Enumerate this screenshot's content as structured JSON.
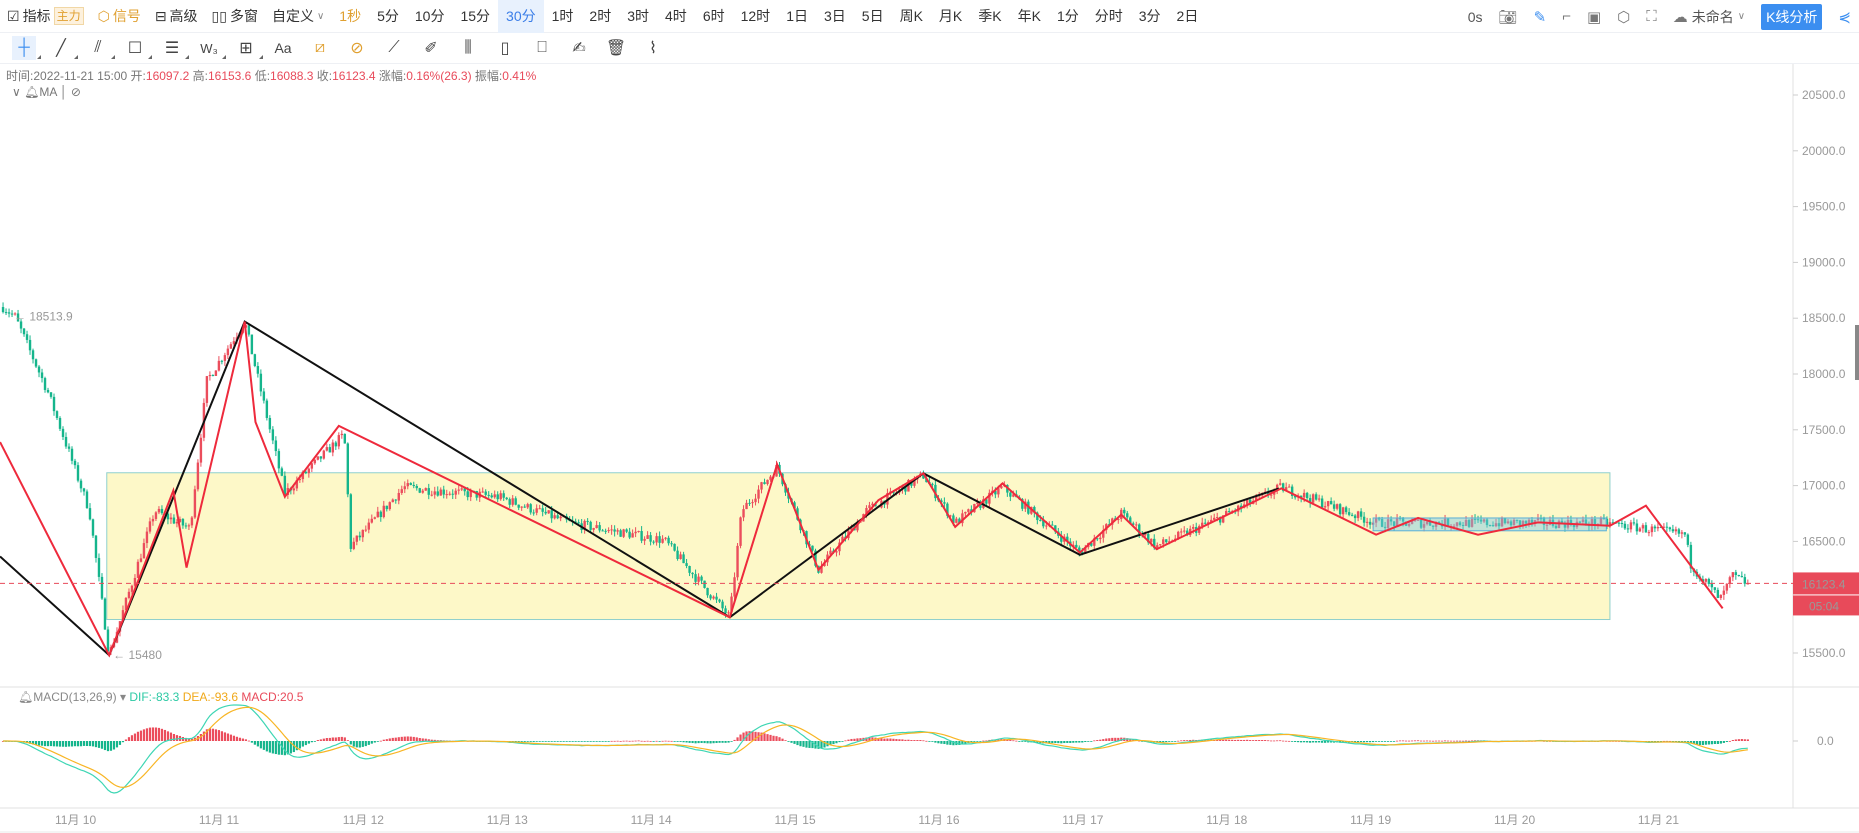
{
  "toolbar": {
    "indicator": "指标",
    "main_badge": "主力",
    "signal": "信号",
    "advanced": "高级",
    "multi": "多窗",
    "custom": "自定义",
    "timeframes": [
      "1秒",
      "5分",
      "10分",
      "15分",
      "30分",
      "1时",
      "2时",
      "3时",
      "4时",
      "6时",
      "12时",
      "1日",
      "3日",
      "5日",
      "周K",
      "月K",
      "季K",
      "年K",
      "1分",
      "分时",
      "3分",
      "2日"
    ],
    "selected_timeframe": "30分",
    "countdown": "0s",
    "layout_name": "未命名",
    "analysis_button": "K线分析"
  },
  "drawing_tools": [
    "crosshair",
    "trend-line",
    "parallel-channel",
    "rectangle",
    "horizontal-lines",
    "wave",
    "measure-box",
    "text",
    "magnet",
    "lock",
    "ruler",
    "brush",
    "candles-pattern",
    "note",
    "bookmark",
    "edit",
    "delete",
    "attach"
  ],
  "ohlc": {
    "time_label": "时间:",
    "time": "2022-11-21 15:00",
    "open_label": "开:",
    "open": "16097.2",
    "high_label": "高:",
    "high": "16153.6",
    "low_label": "低:",
    "low": "16088.3",
    "close_label": "收:",
    "close": "16123.4",
    "change_label": "涨幅:",
    "change": "0.16%(26.3)",
    "amp_label": "振幅:",
    "amp": "0.41%"
  },
  "ma_label": "MA",
  "macd": {
    "label": "MACD(13,26,9)",
    "dif": "DIF:-83.3",
    "dea": "DEA:-93.6",
    "macd": "MACD:20.5",
    "zero": "0.0"
  },
  "colors": {
    "up": "#eb4d5c",
    "down": "#15b58c",
    "dif": "#3ed6b4",
    "dea": "#f8b524",
    "box": "#fdf8c8"
  },
  "chart_data": {
    "type": "candlestick",
    "interval": "30分",
    "y_ticks": [
      "20500.0",
      "20000.0",
      "19500.0",
      "19000.0",
      "18500.0",
      "18000.0",
      "17500.0",
      "17000.0",
      "16500.0",
      "15500.0"
    ],
    "ylim": [
      15500,
      20500
    ],
    "x_ticks": [
      "11月 10",
      "11月 11",
      "11月 12",
      "11月 13",
      "11月 14",
      "11月 15",
      "11月 16",
      "11月 17",
      "11月 18",
      "11月 19",
      "11月 20",
      "11月 21"
    ],
    "last_price": "16123.4",
    "countdown": "05:04",
    "max_label": "18513.9",
    "min_label": "15480",
    "anchors_hours_price": [
      [
        -12,
        18600
      ],
      [
        -10,
        18513.9
      ],
      [
        -4.5,
        17835
      ],
      [
        2.4,
        16775
      ],
      [
        5.7,
        15480
      ],
      [
        13.3,
        16775
      ],
      [
        19.2,
        16615
      ],
      [
        22,
        17940
      ],
      [
        28.3,
        18470
      ],
      [
        35,
        16930
      ],
      [
        44.9,
        17460
      ],
      [
        46,
        16455
      ],
      [
        54.8,
        16985
      ],
      [
        70.6,
        16900
      ],
      [
        82.5,
        16665
      ],
      [
        98.3,
        16510
      ],
      [
        109.2,
        15820
      ],
      [
        111.2,
        16775
      ],
      [
        117.1,
        17165
      ],
      [
        124,
        16245
      ],
      [
        132,
        16775
      ],
      [
        141.5,
        17090
      ],
      [
        146.8,
        16665
      ],
      [
        154.7,
        16985
      ],
      [
        167.6,
        16400
      ],
      [
        174.5,
        16750
      ],
      [
        180.4,
        16455
      ],
      [
        191.3,
        16720
      ],
      [
        201.2,
        16985
      ],
      [
        217,
        16665
      ],
      [
        244.8,
        16665
      ],
      [
        255.6,
        16665
      ],
      [
        268.5,
        16560
      ],
      [
        269.5,
        16295
      ],
      [
        274.4,
        15975
      ],
      [
        276.4,
        16190
      ],
      [
        279,
        16123.4
      ]
    ],
    "black_zigzag": [
      [
        -12.5,
        16365
      ],
      [
        5.7,
        15480
      ],
      [
        28.3,
        18470
      ],
      [
        109.2,
        15820
      ],
      [
        141.5,
        17110
      ],
      [
        167.6,
        16380
      ],
      [
        200.8,
        16975
      ]
    ],
    "red_zigzag": [
      [
        -12.5,
        17390
      ],
      [
        5.7,
        15480
      ],
      [
        16.4,
        16955
      ],
      [
        18.6,
        16265
      ],
      [
        28.3,
        18470
      ],
      [
        30.1,
        17570
      ],
      [
        35,
        16900
      ],
      [
        44,
        17535
      ],
      [
        109.2,
        15820
      ],
      [
        117.1,
        17190
      ],
      [
        124,
        16245
      ],
      [
        134,
        16870
      ],
      [
        141.5,
        17110
      ],
      [
        146.8,
        16630
      ],
      [
        154.7,
        17020
      ],
      [
        167.6,
        16400
      ],
      [
        174.5,
        16740
      ],
      [
        180.4,
        16430
      ],
      [
        201.2,
        16975
      ],
      [
        217,
        16560
      ],
      [
        224,
        16710
      ],
      [
        234,
        16560
      ],
      [
        244,
        16670
      ],
      [
        256,
        16640
      ],
      [
        262,
        16820
      ],
      [
        274.8,
        15900
      ]
    ],
    "box": {
      "t": [
        5.3,
        256
      ],
      "p": [
        15800,
        17115
      ]
    },
    "small_box": {
      "t": [
        216.5,
        255.4
      ],
      "p": [
        16595,
        16710
      ]
    }
  }
}
